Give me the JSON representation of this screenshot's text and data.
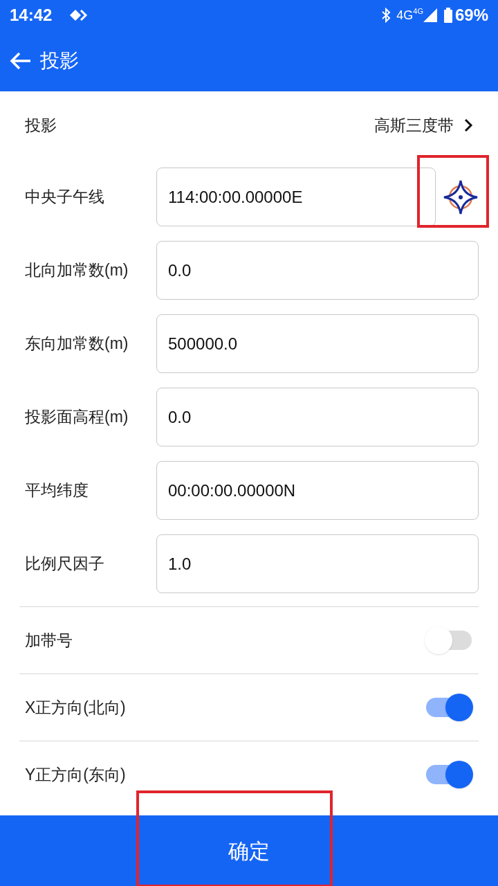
{
  "status_bar": {
    "time": "14:42",
    "network": "4G",
    "network_secondary": "4G",
    "battery": "69%"
  },
  "app_bar": {
    "title": "投影"
  },
  "projection": {
    "label": "投影",
    "value": "高斯三度带"
  },
  "fields": [
    {
      "label": "中央子午线",
      "value": "114:00:00.00000E",
      "kind": "picker"
    },
    {
      "label": "北向加常数(m)",
      "value": "0.0",
      "kind": "plain"
    },
    {
      "label": "东向加常数(m)",
      "value": "500000.0",
      "kind": "plain"
    },
    {
      "label": "投影面高程(m)",
      "value": "0.0",
      "kind": "plain"
    },
    {
      "label": "平均纬度",
      "value": "00:00:00.00000N",
      "kind": "plain"
    },
    {
      "label": "比例尺因子",
      "value": "1.0",
      "kind": "plain"
    }
  ],
  "toggles": [
    {
      "label": "加带号",
      "on": false
    },
    {
      "label": "X正方向(北向)",
      "on": true
    },
    {
      "label": "Y正方向(东向)",
      "on": true
    }
  ],
  "confirm_button": "确定"
}
